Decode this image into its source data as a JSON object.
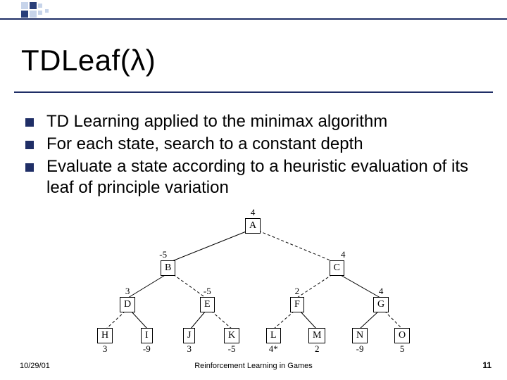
{
  "title": "TDLeaf(λ)",
  "bullets": [
    "TD Learning applied to the minimax algorithm",
    "For each state, search to a constant depth",
    "Evaluate a state according to a heuristic evaluation of its leaf of principle variation"
  ],
  "tree": {
    "A": {
      "label": "A",
      "value": "4"
    },
    "B": {
      "label": "B",
      "value": "-5"
    },
    "C": {
      "label": "C",
      "value": "4"
    },
    "D": {
      "label": "D",
      "value": "3"
    },
    "E": {
      "label": "E",
      "value": "-5"
    },
    "F": {
      "label": "F",
      "value": "2"
    },
    "G": {
      "label": "G",
      "value": "4"
    },
    "H": {
      "label": "H",
      "value": "3"
    },
    "I": {
      "label": "I",
      "value": "-9"
    },
    "J": {
      "label": "J",
      "value": "3"
    },
    "K": {
      "label": "K",
      "value": "-5"
    },
    "L": {
      "label": "L",
      "value": "4*"
    },
    "M": {
      "label": "M",
      "value": "2"
    },
    "N": {
      "label": "N",
      "value": "-9"
    },
    "O": {
      "label": "O",
      "value": "5"
    }
  },
  "footer": {
    "date": "10/29/01",
    "center": "Reinforcement Learning in Games",
    "page": "11"
  }
}
